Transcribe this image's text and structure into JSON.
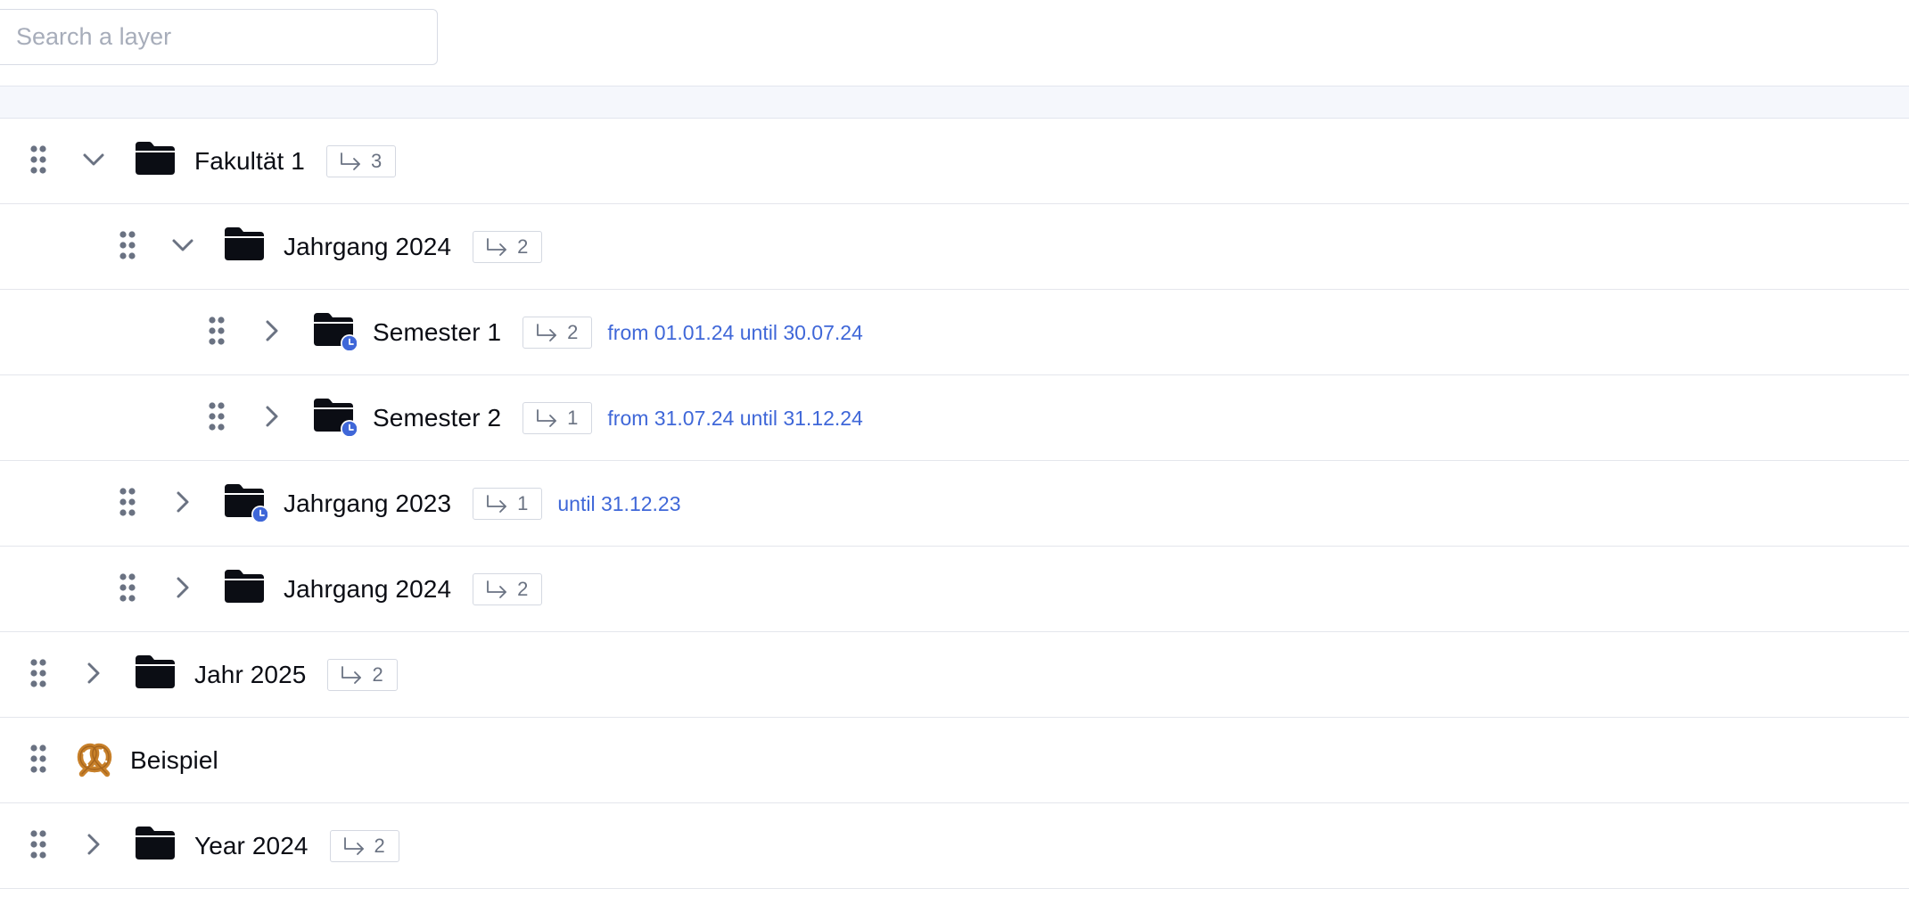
{
  "search": {
    "placeholder": "Search a layer",
    "value": ""
  },
  "colors": {
    "accent": "#3f67d8",
    "folder": "#0b0d14",
    "muted": "#6a7282",
    "border": "#e4e6ec"
  },
  "tree": {
    "rows": [
      {
        "name": "Fakultät 1",
        "level": 0,
        "expanded": true,
        "icon": "folder-icon",
        "children_count": "3",
        "schedule": ""
      },
      {
        "name": "Jahrgang 2024",
        "level": 1,
        "expanded": true,
        "icon": "folder-icon",
        "children_count": "2",
        "schedule": ""
      },
      {
        "name": "Semester 1",
        "level": 2,
        "expanded": false,
        "icon": "scheduled-folder-icon",
        "children_count": "2",
        "schedule": "from 01.01.24 until 30.07.24"
      },
      {
        "name": "Semester 2",
        "level": 2,
        "expanded": false,
        "icon": "scheduled-folder-icon",
        "children_count": "1",
        "schedule": "from 31.07.24 until 31.12.24"
      },
      {
        "name": "Jahrgang 2023",
        "level": 1,
        "expanded": false,
        "icon": "scheduled-folder-icon",
        "children_count": "1",
        "schedule": "until 31.12.23"
      },
      {
        "name": "Jahrgang 2024",
        "level": 1,
        "expanded": false,
        "icon": "folder-icon",
        "children_count": "2",
        "schedule": ""
      },
      {
        "name": "Jahr 2025",
        "level": 0,
        "expanded": false,
        "icon": "folder-icon",
        "children_count": "2",
        "schedule": ""
      },
      {
        "name": "Beispiel",
        "level": 0,
        "expanded": null,
        "icon": "pretzel-icon",
        "children_count": "",
        "schedule": ""
      },
      {
        "name": "Year 2024",
        "level": 0,
        "expanded": false,
        "icon": "folder-icon",
        "children_count": "2",
        "schedule": ""
      }
    ]
  }
}
